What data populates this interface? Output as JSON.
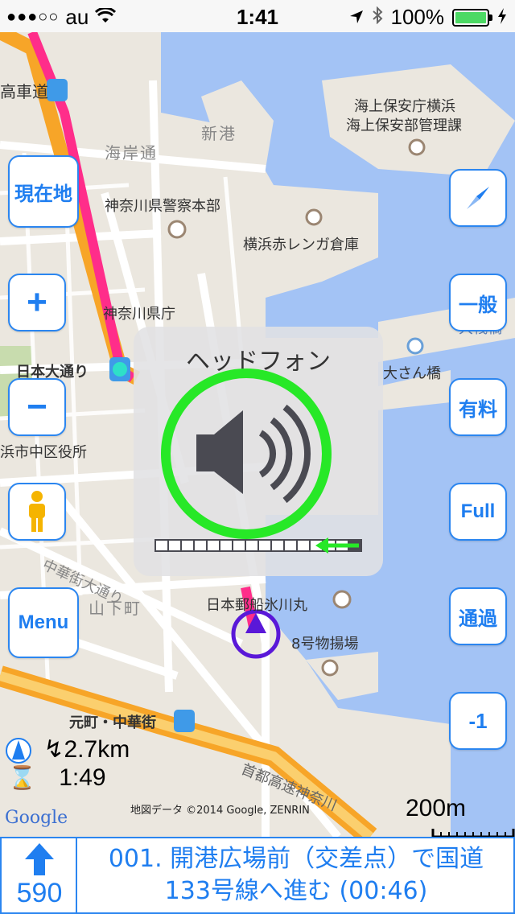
{
  "status": {
    "carrier": "au",
    "signal_dots": "●●●○○",
    "time": "1:41",
    "battery_percent": "100%"
  },
  "map": {
    "labels": {
      "rail_station": "高車道",
      "shinko": "新港",
      "kaigan": "海岸通",
      "coast_guard": "海上保安庁横浜",
      "coast_guard2": "海上保安部管理課",
      "police": "神奈川県警察本部",
      "red_brick": "横浜赤レンガ倉庫",
      "pref_office": "神奈川県庁",
      "nihon_odori": "日本大通り",
      "osanbashi": "大さん橋",
      "osanbashi_small": "大桟橋",
      "ward_office": "浜市中区役所",
      "chinatown_st": "中華街大通り",
      "yamashita": "山下町",
      "hikawamaru": "日本郵船氷川丸",
      "pier8": "8号物揚場",
      "motomachi": "元町・中華街",
      "expressway": "首都高速神奈川",
      "copyright": "地図データ ©2014 Google, ZENRIN",
      "google": "Google",
      "scale": "200m"
    }
  },
  "buttons": {
    "current_location": "現在地",
    "zoom_in": "+",
    "zoom_out": "−",
    "menu": "Menu",
    "general": "一般",
    "toll": "有料",
    "full": "Full",
    "pass": "通過",
    "minus_one": "-1"
  },
  "hud": {
    "title": "ヘッドフォン",
    "volume_level": 0.92,
    "volume_segments": 16
  },
  "trip": {
    "remaining_distance": "2.7km",
    "remaining_time": "1:49"
  },
  "guidance": {
    "distance": "590",
    "instruction_line1": "001. 開港広場前（交差点）で国道",
    "instruction_line2": "133号線へ進む (00:46)"
  },
  "colors": {
    "accent": "#1f7ef0",
    "water": "#a3c3f5",
    "land": "#ebe7df",
    "route": "#ff2d8a",
    "highway": "#f7a528",
    "volume_ring": "#27e827"
  }
}
